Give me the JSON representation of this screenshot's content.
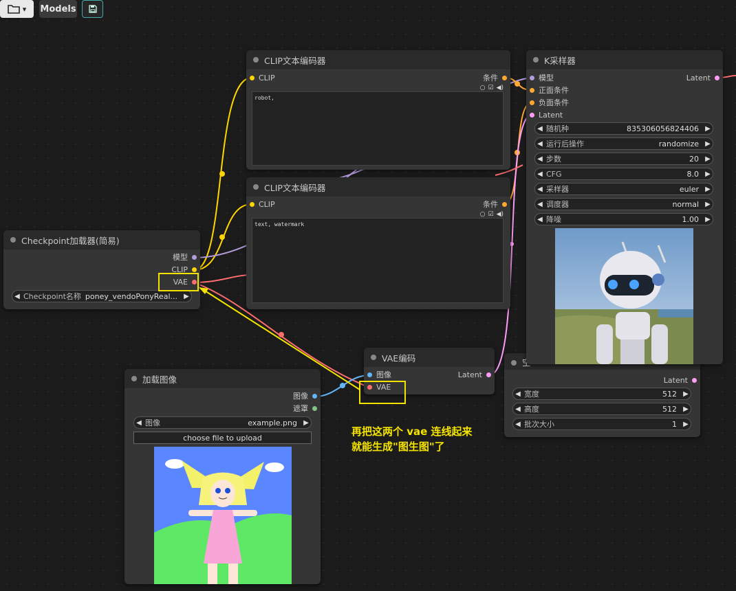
{
  "toolbar": {
    "folder_icon": "folder-icon",
    "folder_caret": "▾",
    "models_label": "Models",
    "save_icon": "floppy-disk-icon"
  },
  "colors": {
    "clip": "#ffd500",
    "model": "#b39ddb",
    "vae": "#ff6e6e",
    "conditioning": "#ffa931",
    "latent": "#ff9cf9",
    "image": "#64b5f6",
    "mask": "#81c784",
    "annotation": "#f5e400"
  },
  "clip_pos": {
    "title": "CLIP文本编码器",
    "input": "CLIP",
    "output": "条件",
    "text": "robot,"
  },
  "clip_neg": {
    "title": "CLIP文本编码器",
    "input": "CLIP",
    "output": "条件",
    "text": "text, watermark"
  },
  "checkpoint": {
    "title": "Checkpoint加载器(简易)",
    "outputs": [
      "模型",
      "CLIP",
      "VAE"
    ],
    "widget_label": "Checkpoint名称",
    "widget_value": "poney_vendoPonyReal..."
  },
  "ksampler": {
    "title": "K采样器",
    "inputs": [
      "模型",
      "正面条件",
      "负面条件",
      "Latent"
    ],
    "output": "Latent",
    "widgets": [
      {
        "label": "随机种",
        "value": "835306056824406"
      },
      {
        "label": "运行后操作",
        "value": "randomize"
      },
      {
        "label": "步数",
        "value": "20"
      },
      {
        "label": "CFG",
        "value": "8.0"
      },
      {
        "label": "采样器",
        "value": "euler"
      },
      {
        "label": "调度器",
        "value": "normal"
      },
      {
        "label": "降噪",
        "value": "1.00"
      }
    ]
  },
  "vae_encode": {
    "title": "VAE编码",
    "inputs": [
      "图像",
      "VAE"
    ],
    "output": "Latent"
  },
  "latent_image": {
    "title_partial": "空",
    "output": "Latent",
    "widgets": [
      {
        "label": "宽度",
        "value": "512"
      },
      {
        "label": "高度",
        "value": "512"
      },
      {
        "label": "批次大小",
        "value": "1"
      }
    ]
  },
  "load_image": {
    "title": "加载图像",
    "outputs": [
      "图像",
      "遮罩"
    ],
    "widget_label": "图像",
    "widget_value": "example.png",
    "upload_label": "choose file to upload"
  },
  "annotation": {
    "line1": "再把这两个 vae 连线起来",
    "line2": "就能生成\"图生图\"了"
  }
}
